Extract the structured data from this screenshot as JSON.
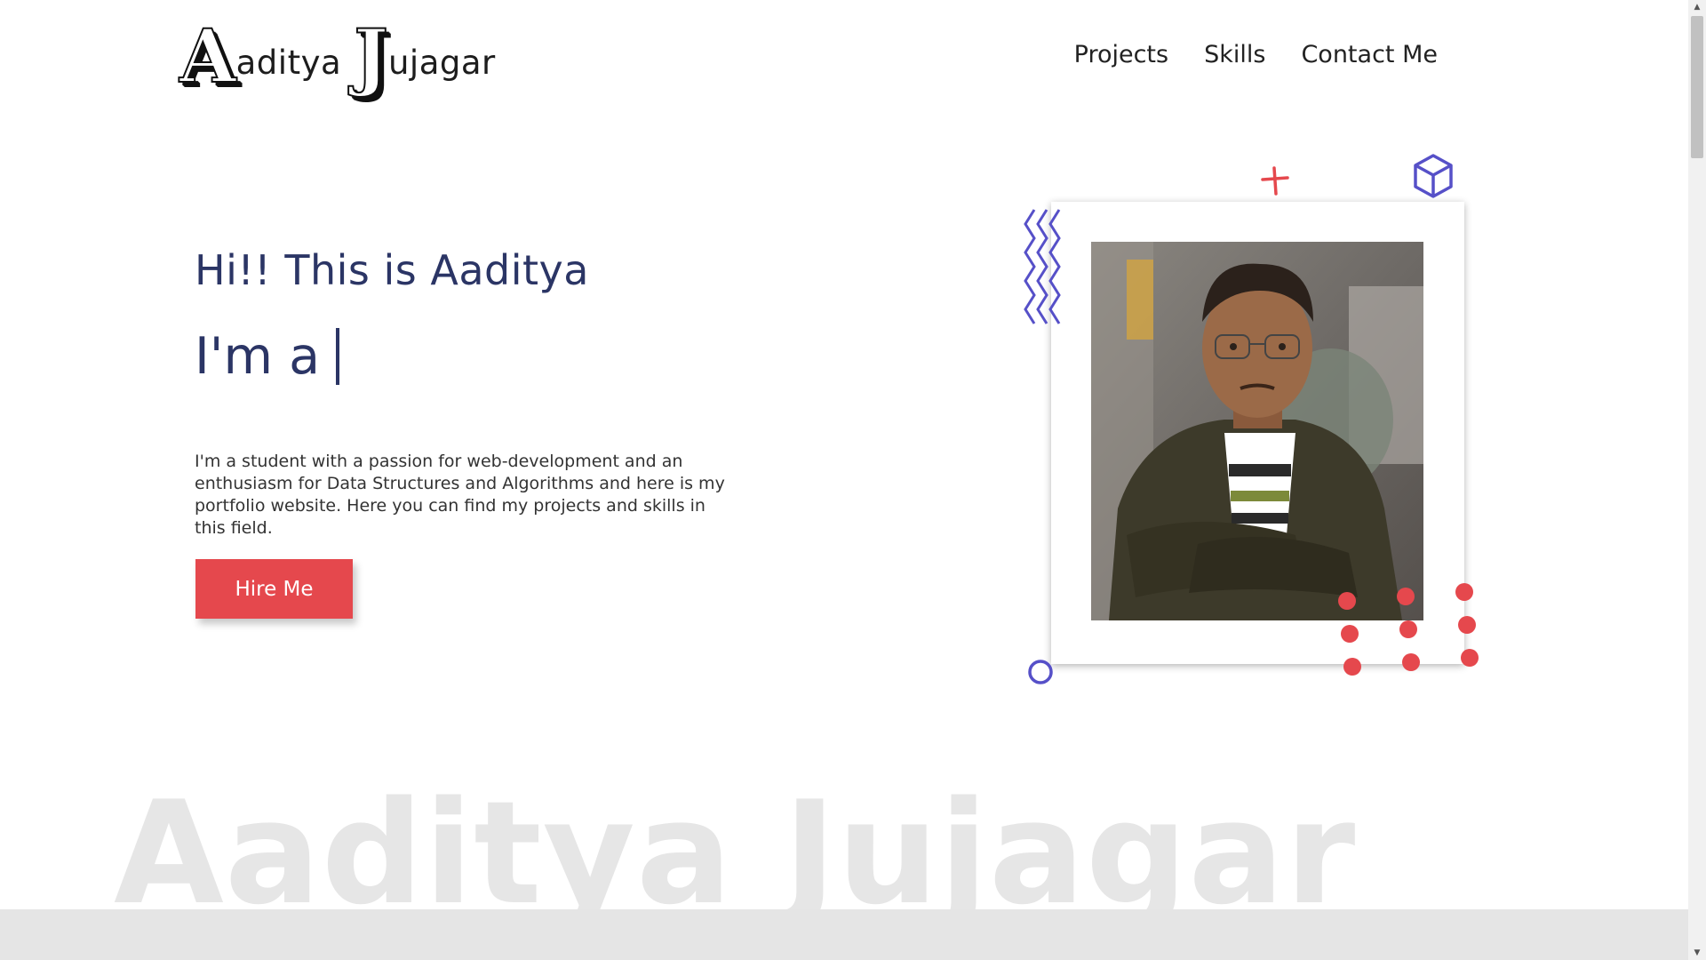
{
  "header": {
    "logo": {
      "first_initial": "A",
      "first_rest": "aditya",
      "last_initial": "J",
      "last_rest": "ujagar"
    },
    "nav": [
      {
        "label": "Projects"
      },
      {
        "label": "Skills"
      },
      {
        "label": "Contact Me"
      }
    ]
  },
  "hero": {
    "greeting": "Hi!! This is Aaditya",
    "typing_prefix": "I'm a",
    "description": "I'm a student with a passion for web-development and an enthusiasm for Data Structures and Algorithms and here is my portfolio website. Here you can find my projects and skills in this field.",
    "hire_button": "Hire Me"
  },
  "watermark": "Aaditya Jujagar",
  "colors": {
    "accent_red": "#e5484d",
    "accent_purple": "#5650c8",
    "heading_navy": "#2b3565"
  },
  "icons": {
    "decorations": [
      "zigzag-icon",
      "plus-icon",
      "cube-icon",
      "circle-icon",
      "dots-grid-icon"
    ]
  }
}
